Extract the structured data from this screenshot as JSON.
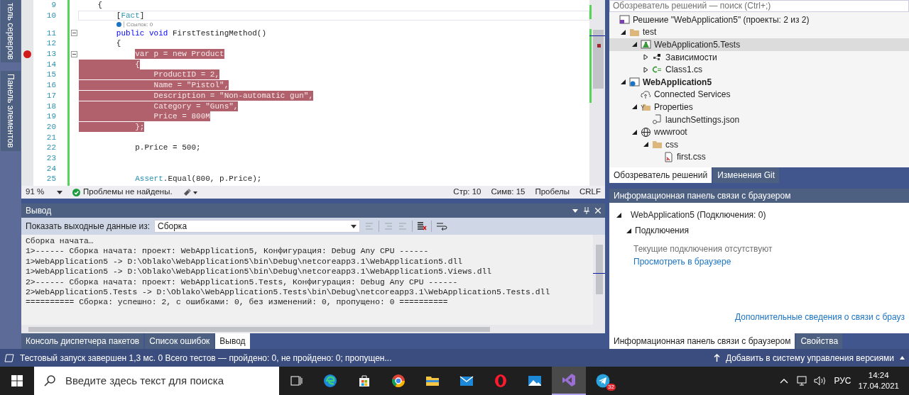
{
  "left_dock": {
    "tabs": [
      {
        "label": "тель серверов"
      },
      {
        "label": "Панель элементов"
      }
    ]
  },
  "editor": {
    "lines": [
      {
        "kind": "code",
        "number": "9",
        "segments": [
          {
            "text": "    {",
            "kind": "plain"
          }
        ],
        "selected": false,
        "breakpoint": false,
        "current": false,
        "foldable": false
      },
      {
        "kind": "code",
        "number": "10",
        "segments": [
          {
            "text": "        [",
            "kind": "plain"
          },
          {
            "text": "Fact",
            "kind": "type"
          },
          {
            "text": "]",
            "kind": "plain"
          }
        ],
        "selected": false,
        "breakpoint": false,
        "current": true,
        "foldable": false
      },
      {
        "kind": "codelens",
        "text": "Ссылок: 0"
      },
      {
        "kind": "code",
        "number": "11",
        "segments": [
          {
            "text": "        public",
            "kind": "keyword"
          },
          {
            "text": " void",
            "kind": "keyword"
          },
          {
            "text": " FirstTestingMethod()",
            "kind": "plain"
          }
        ],
        "selected": false,
        "breakpoint": false,
        "current": false,
        "foldable": true
      },
      {
        "kind": "code",
        "number": "12",
        "segments": [
          {
            "text": "        {",
            "kind": "plain"
          }
        ],
        "selected": false,
        "breakpoint": false,
        "current": false,
        "foldable": false
      },
      {
        "kind": "code",
        "number": "13",
        "segments": [
          {
            "text": "            var",
            "kind": "keyword"
          },
          {
            "text": " p = ",
            "kind": "plain"
          },
          {
            "text": "new",
            "kind": "keyword"
          },
          {
            "text": " Product",
            "kind": "type"
          }
        ],
        "selected": true,
        "selection_includes_indent": false,
        "breakpoint": true,
        "current": false,
        "foldable": true
      },
      {
        "kind": "code",
        "number": "14",
        "segments": [
          {
            "text": "            {",
            "kind": "plain"
          }
        ],
        "selected": true,
        "selection_includes_indent": true,
        "breakpoint": false,
        "current": false,
        "foldable": false
      },
      {
        "kind": "code",
        "number": "15",
        "segments": [
          {
            "text": "                ProductID = 2,",
            "kind": "plain"
          }
        ],
        "selected": true,
        "selection_includes_indent": true,
        "breakpoint": false,
        "current": false,
        "foldable": false
      },
      {
        "kind": "code",
        "number": "16",
        "segments": [
          {
            "text": "                Name = ",
            "kind": "plain"
          },
          {
            "text": "\"Pistol\"",
            "kind": "string"
          },
          {
            "text": ",",
            "kind": "plain"
          }
        ],
        "selected": true,
        "selection_includes_indent": true,
        "breakpoint": false,
        "current": false,
        "foldable": false
      },
      {
        "kind": "code",
        "number": "17",
        "segments": [
          {
            "text": "                Description = ",
            "kind": "plain"
          },
          {
            "text": "\"Non-automatic gun\"",
            "kind": "string"
          },
          {
            "text": ",",
            "kind": "plain"
          }
        ],
        "selected": true,
        "selection_includes_indent": true,
        "breakpoint": false,
        "current": false,
        "foldable": false
      },
      {
        "kind": "code",
        "number": "18",
        "segments": [
          {
            "text": "                Category = ",
            "kind": "plain"
          },
          {
            "text": "\"Guns\"",
            "kind": "string"
          },
          {
            "text": ",",
            "kind": "plain"
          }
        ],
        "selected": true,
        "selection_includes_indent": true,
        "breakpoint": false,
        "current": false,
        "foldable": false
      },
      {
        "kind": "code",
        "number": "19",
        "segments": [
          {
            "text": "                Price = 800M",
            "kind": "plain"
          }
        ],
        "selected": true,
        "selection_includes_indent": true,
        "breakpoint": false,
        "current": false,
        "foldable": false
      },
      {
        "kind": "code",
        "number": "20",
        "segments": [
          {
            "text": "            };",
            "kind": "plain"
          }
        ],
        "selected": true,
        "selection_includes_indent": true,
        "breakpoint": false,
        "current": false,
        "foldable": false
      },
      {
        "kind": "code",
        "number": "21",
        "selected": false,
        "breakpoint": false,
        "current": false,
        "foldable": false
      },
      {
        "kind": "code",
        "number": "22",
        "segments": [
          {
            "text": "            p.Price = 500;",
            "kind": "plain"
          }
        ],
        "selected": false,
        "breakpoint": false,
        "current": false,
        "foldable": false
      },
      {
        "kind": "code",
        "number": "23",
        "selected": false,
        "breakpoint": false,
        "current": false,
        "foldable": false
      },
      {
        "kind": "code",
        "number": "24",
        "selected": false,
        "breakpoint": false,
        "current": false,
        "foldable": false
      },
      {
        "kind": "code",
        "number": "25",
        "segments": [
          {
            "text": "            Assert",
            "kind": "type"
          },
          {
            "text": ".Equal(800, p.Price);",
            "kind": "plain"
          }
        ],
        "selected": false,
        "breakpoint": false,
        "current": false,
        "foldable": false
      }
    ],
    "status": {
      "zoom": "91 %",
      "issues": "Проблемы не найдены.",
      "line": "Стр: 10",
      "column": "Симв: 15",
      "indentation": "Пробелы",
      "line_ending": "CRLF"
    }
  },
  "output": {
    "title": "Вывод",
    "source_label": "Показать выходные данные из:",
    "source": "Сборка",
    "lines": [
      "Сборка начата…",
      "1>------ Сборка начата: проект: WebApplication5, Конфигурация: Debug Any CPU ------",
      "1>WebApplication5 -> D:\\Oblako\\WebApplication5\\bin\\Debug\\netcoreapp3.1\\WebApplication5.dll",
      "1>WebApplication5 -> D:\\Oblako\\WebApplication5\\bin\\Debug\\netcoreapp3.1\\WebApplication5.Views.dll",
      "2>------ Сборка начата: проект: WebApplication5.Tests, Конфигурация: Debug Any CPU ------",
      "2>WebApplication5.Tests -> D:\\Oblako\\WebApplication5.Tests\\bin\\Debug\\netcoreapp3.1\\WebApplication5.Tests.dll",
      "========== Сборка: успешно: 2, с ошибками: 0, без изменений: 0, пропущено: 0 =========="
    ],
    "tabs": [
      {
        "label": "Консоль диспетчера пакетов",
        "selected": false
      },
      {
        "label": "Список ошибок",
        "selected": false
      },
      {
        "label": "Вывод",
        "selected": true
      }
    ]
  },
  "solution_explorer": {
    "search_placeholder": "Обозреватель решений — поиск (Ctrl+;)",
    "tree": [
      {
        "label": "Решение \"WebApplication5\" (проекты: 2 из 2)",
        "kind": "solution",
        "selected": false,
        "startup": false,
        "children": [
          {
            "label": "test",
            "kind": "folder",
            "expanded": true,
            "selected": false,
            "startup": false,
            "children": [
              {
                "label": "WebApplication5.Tests",
                "kind": "test-project",
                "expanded": true,
                "selected": true,
                "startup": false,
                "children": [
                  {
                    "label": "Зависимости",
                    "kind": "dependencies",
                    "expanded": false,
                    "selected": false,
                    "startup": false
                  },
                  {
                    "label": "Class1.cs",
                    "kind": "csharp",
                    "expanded": false,
                    "selected": false,
                    "startup": false
                  }
                ]
              }
            ]
          },
          {
            "label": "WebApplication5",
            "kind": "web-project",
            "expanded": true,
            "selected": false,
            "startup": true,
            "children": [
              {
                "label": "Connected Services",
                "kind": "cloud",
                "selected": false,
                "startup": false
              },
              {
                "label": "Properties",
                "kind": "properties",
                "expanded": true,
                "selected": false,
                "startup": false,
                "children": [
                  {
                    "label": "launchSettings.json",
                    "kind": "settings-file",
                    "selected": false,
                    "startup": false
                  }
                ]
              },
              {
                "label": "wwwroot",
                "kind": "globe",
                "expanded": true,
                "selected": false,
                "startup": false,
                "children": [
                  {
                    "label": "css",
                    "kind": "folder",
                    "expanded": true,
                    "selected": false,
                    "startup": false,
                    "children": [
                      {
                        "label": "first.css",
                        "kind": "css-file",
                        "selected": false,
                        "startup": false
                      }
                    ]
                  }
                ]
              }
            ]
          }
        ]
      }
    ],
    "tabs": [
      {
        "label": "Обозреватель решений",
        "selected": true
      },
      {
        "label": "Изменения Git",
        "selected": false
      }
    ]
  },
  "browser_link": {
    "title": "Информационная панель связи с браузером",
    "tree": [
      {
        "label": "WebApplication5 (Подключения: 0)",
        "expanded": true,
        "children": [
          {
            "label": "Подключения",
            "expanded": true
          }
        ]
      }
    ],
    "empty_message": "Текущие подключения отсутствуют",
    "view_link": "Просмотреть в браузере",
    "more_link": "Дополнительные сведения о связи с брауз",
    "tabs": [
      {
        "label": "Информационная панель связи с браузером",
        "selected": true
      },
      {
        "label": "Свойства",
        "selected": false
      }
    ]
  },
  "status_bar": {
    "message": "Тестовый запуск завершен 1,3 мс. 0 Всего тестов — пройдено: 0, не пройдено: 0; пропущен...",
    "source_control": "Добавить в систему управления версиями"
  },
  "taskbar": {
    "search_placeholder": "Введите здесь текст для поиска",
    "apps": [
      {
        "kind": "task-view",
        "selected": false
      },
      {
        "kind": "edge",
        "selected": false
      },
      {
        "kind": "store",
        "selected": false
      },
      {
        "kind": "chrome",
        "selected": false
      },
      {
        "kind": "explorer",
        "selected": false
      },
      {
        "kind": "mail",
        "selected": false
      },
      {
        "kind": "opera",
        "selected": false
      },
      {
        "kind": "photos",
        "selected": false
      },
      {
        "kind": "visual-studio",
        "selected": true
      },
      {
        "kind": "telegram",
        "selected": false,
        "badge": "32"
      }
    ],
    "language": "РУС",
    "time": "14:24",
    "date": "17.04.2021"
  }
}
